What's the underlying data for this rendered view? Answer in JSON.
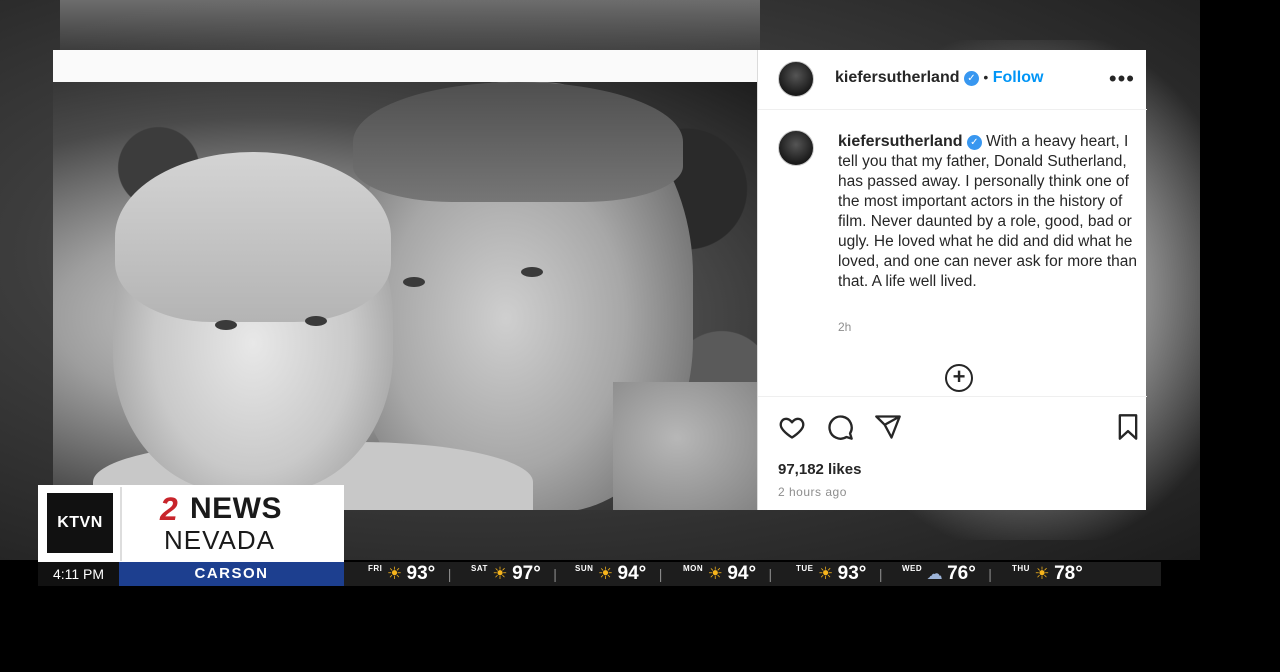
{
  "post": {
    "username": "kiefersutherland",
    "dot": "•",
    "follow_label": "Follow",
    "more_label": "•••",
    "caption": "With a heavy heart, I tell you that my father, Donald Sutherland, has passed away. I personally think one of the most important actors in the history of film. Never daunted by a role, good, bad or ugly. He loved what he did and did what he loved, and one can never ask for more than that. A life well lived.",
    "caption_time": "2h",
    "likes": "97,182 likes",
    "posted_ago": "2 hours ago"
  },
  "broadcast": {
    "station": "KTVN",
    "brand_number": "2",
    "brand_news": "NEWS",
    "brand_region": "NEVADA",
    "clock": "4:11 PM",
    "city": "CARSON",
    "accent_color": "#c8242b",
    "city_bar_color": "#1d3f8f",
    "forecast": [
      {
        "day": "FRI",
        "icon": "sun-icon",
        "temp": "93°"
      },
      {
        "day": "SAT",
        "icon": "sun-icon",
        "temp": "97°"
      },
      {
        "day": "SUN",
        "icon": "sun-icon",
        "temp": "94°"
      },
      {
        "day": "MON",
        "icon": "sun-icon",
        "temp": "94°"
      },
      {
        "day": "TUE",
        "icon": "sun-icon",
        "temp": "93°"
      },
      {
        "day": "WED",
        "icon": "wind-cloud-icon",
        "temp": "76°"
      },
      {
        "day": "THU",
        "icon": "sun-icon",
        "temp": "78°"
      }
    ]
  }
}
